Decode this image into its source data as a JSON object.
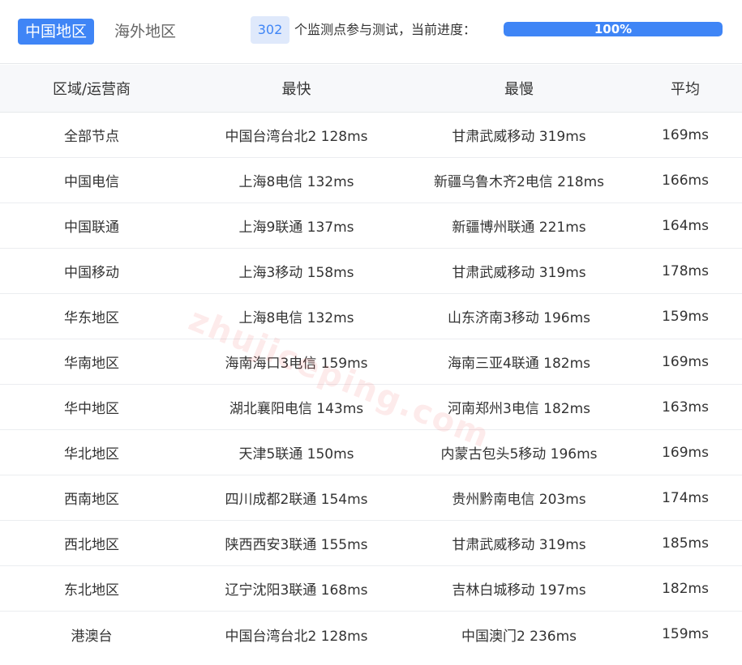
{
  "tabs": [
    {
      "label": "中国地区",
      "active": true
    },
    {
      "label": "海外地区",
      "active": false
    }
  ],
  "monitor": {
    "count": "302",
    "label": "个监测点参与测试，当前进度：",
    "progress_text": "100%",
    "progress_fraction": 1.0
  },
  "table": {
    "headers": [
      "区域/运营商",
      "最快",
      "最慢",
      "平均"
    ],
    "rows": [
      [
        "全部节点",
        "中国台湾台北2 128ms",
        "甘肃武威移动 319ms",
        "169ms"
      ],
      [
        "中国电信",
        "上海8电信 132ms",
        "新疆乌鲁木齐2电信 218ms",
        "166ms"
      ],
      [
        "中国联通",
        "上海9联通 137ms",
        "新疆博州联通 221ms",
        "164ms"
      ],
      [
        "中国移动",
        "上海3移动 158ms",
        "甘肃武威移动 319ms",
        "178ms"
      ],
      [
        "华东地区",
        "上海8电信 132ms",
        "山东济南3移动 196ms",
        "159ms"
      ],
      [
        "华南地区",
        "海南海口3电信 159ms",
        "海南三亚4联通 182ms",
        "169ms"
      ],
      [
        "华中地区",
        "湖北襄阳电信 143ms",
        "河南郑州3电信 182ms",
        "163ms"
      ],
      [
        "华北地区",
        "天津5联通 150ms",
        "内蒙古包头5移动 196ms",
        "169ms"
      ],
      [
        "西南地区",
        "四川成都2联通 154ms",
        "贵州黔南电信 203ms",
        "174ms"
      ],
      [
        "西北地区",
        "陕西西安3联通 155ms",
        "甘肃武威移动 319ms",
        "185ms"
      ],
      [
        "东北地区",
        "辽宁沈阳3联通 168ms",
        "吉林白城移动 197ms",
        "182ms"
      ],
      [
        "港澳台",
        "中国台湾台北2 128ms",
        "中国澳门2 236ms",
        "159ms"
      ]
    ]
  },
  "watermark": "zhujiceping.com",
  "colors": {
    "accent": "#3f85f6",
    "badge_bg": "#dfe9fb",
    "header_bg": "#f7f8fa"
  }
}
